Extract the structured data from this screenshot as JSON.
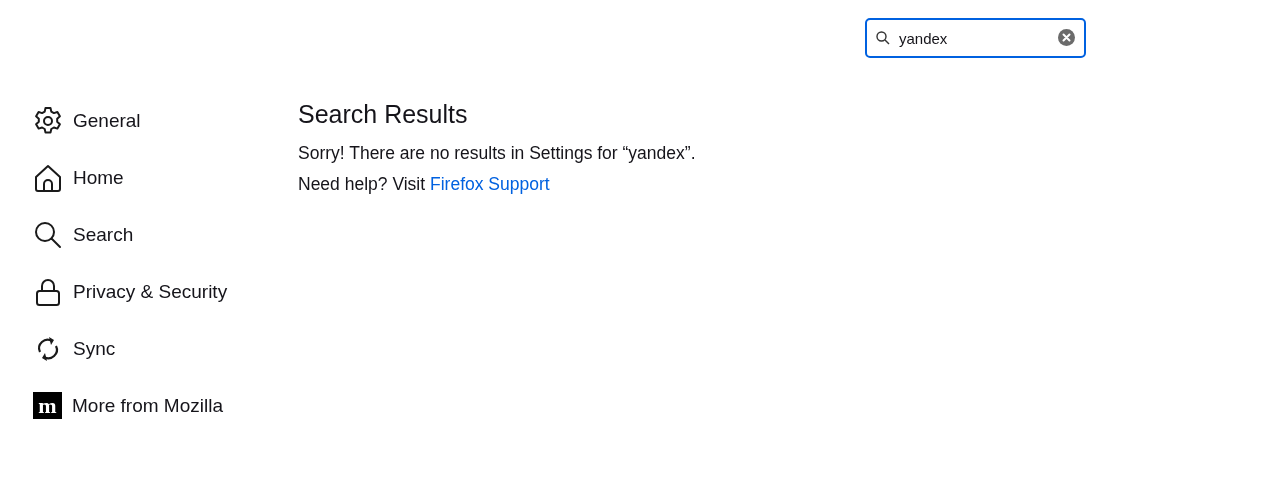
{
  "search": {
    "value": "yandex"
  },
  "sidebar": {
    "items": [
      {
        "label": "General"
      },
      {
        "label": "Home"
      },
      {
        "label": "Search"
      },
      {
        "label": "Privacy & Security"
      },
      {
        "label": "Sync"
      },
      {
        "label": "More from Mozilla",
        "logo_text": "m"
      }
    ]
  },
  "results": {
    "title": "Search Results",
    "message": "Sorry! There are no results in Settings for “yandex”.",
    "help_text": "Need help? Visit",
    "help_link": "Firefox Support"
  }
}
